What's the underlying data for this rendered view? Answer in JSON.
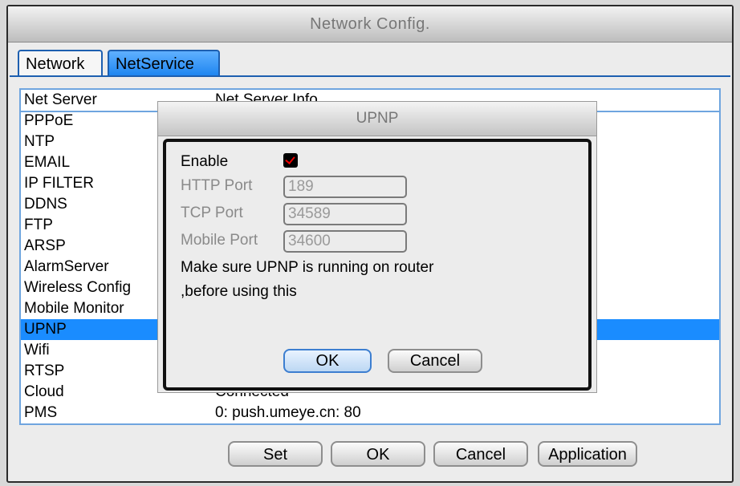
{
  "window": {
    "title": "Network Config."
  },
  "tabs": [
    {
      "label": "Network",
      "active": false
    },
    {
      "label": "NetService",
      "active": true
    }
  ],
  "list": {
    "headers": [
      "Net Server",
      "Net Server Info"
    ],
    "rows": [
      {
        "name": "PPPoE",
        "info": ""
      },
      {
        "name": "NTP",
        "info": ""
      },
      {
        "name": "EMAIL",
        "info": ""
      },
      {
        "name": "IP FILTER",
        "info": ""
      },
      {
        "name": "DDNS",
        "info": ""
      },
      {
        "name": "FTP",
        "info": ""
      },
      {
        "name": "ARSP",
        "info": ""
      },
      {
        "name": "AlarmServer",
        "info": ""
      },
      {
        "name": "Wireless Config",
        "info": ""
      },
      {
        "name": "Mobile Monitor",
        "info": ""
      },
      {
        "name": "UPNP",
        "info": "",
        "selected": true
      },
      {
        "name": "Wifi",
        "info": ""
      },
      {
        "name": "RTSP",
        "info": ""
      },
      {
        "name": "Cloud",
        "info": "Connected"
      },
      {
        "name": "PMS",
        "info": "0: push.umeye.cn: 80"
      }
    ]
  },
  "buttons": {
    "set": "Set",
    "ok": "OK",
    "cancel": "Cancel",
    "application": "Application"
  },
  "dialog": {
    "title": "UPNP",
    "enable_label": "Enable",
    "enable_checked": true,
    "http_port_label": "HTTP Port",
    "http_port_value": "189",
    "tcp_port_label": "TCP Port",
    "tcp_port_value": "34589",
    "mobile_port_label": "Mobile Port",
    "mobile_port_value": "34600",
    "note_line1": "Make sure UPNP is running on router",
    "note_line2": ",before using this",
    "ok": "OK",
    "cancel": "Cancel"
  },
  "colors": {
    "selection": "#1a8cff",
    "accent_border": "#1d5fb0",
    "checkmark": "#e00000"
  }
}
